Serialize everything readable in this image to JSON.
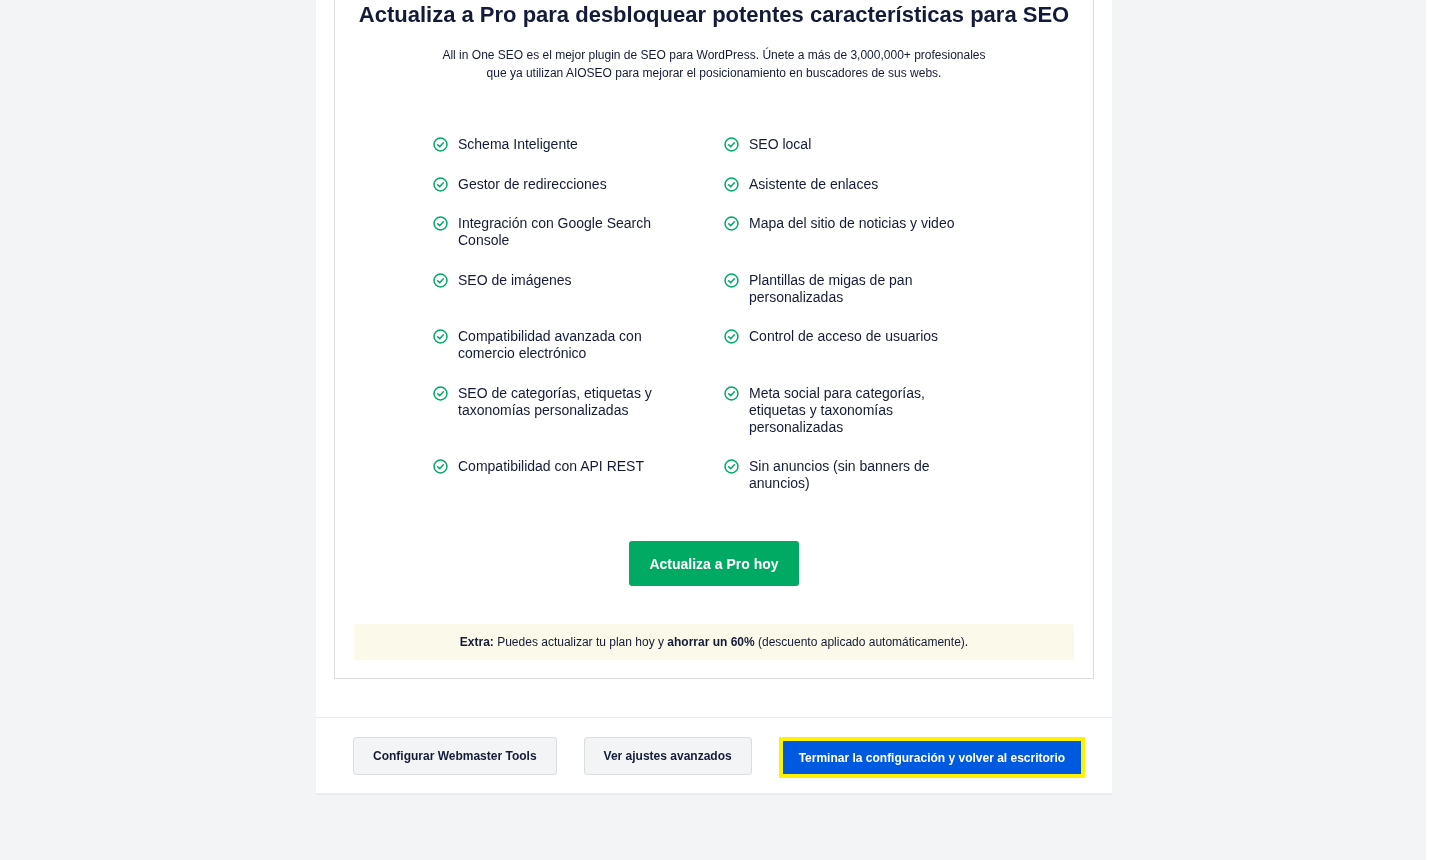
{
  "upgrade": {
    "title": "Actualiza a Pro para desbloquear potentes características para SEO",
    "description": "All in One SEO es el mejor plugin de SEO para WordPress. Únete a más de 3,000,000+ profesionales que ya utilizan AIOSEO para mejorar el posicionamiento en buscadores de sus webs.",
    "features": [
      "Schema Inteligente",
      "SEO local",
      "Gestor de redirecciones",
      "Asistente de enlaces",
      "Integración con Google Search Console",
      "Mapa del sitio de noticias y video",
      "SEO de imágenes",
      "Plantillas de migas de pan personalizadas",
      "Compatibilidad avanzada con comercio electrónico",
      "Control de acceso de usuarios",
      "SEO de categorías, etiquetas y taxonomías personalizadas",
      "Meta social para categorías, etiquetas y taxonomías personalizadas",
      "Compatibilidad con API REST",
      "Sin anuncios (sin banners de anuncios)"
    ],
    "button": "Actualiza a Pro hoy",
    "note": "**Extra:** Puedes actualizar tu plan hoy y **ahorrar un 60%** (descuento aplicado automáticamente)."
  },
  "footer": {
    "buttons": [
      {
        "label": "Configurar Webmaster Tools",
        "kind": "secondary",
        "focused": false
      },
      {
        "label": "Ver ajustes avanzados",
        "kind": "secondary",
        "focused": false
      },
      {
        "label": "Terminar la configuración y volver al escritorio",
        "kind": "primary",
        "focused": true
      }
    ]
  }
}
